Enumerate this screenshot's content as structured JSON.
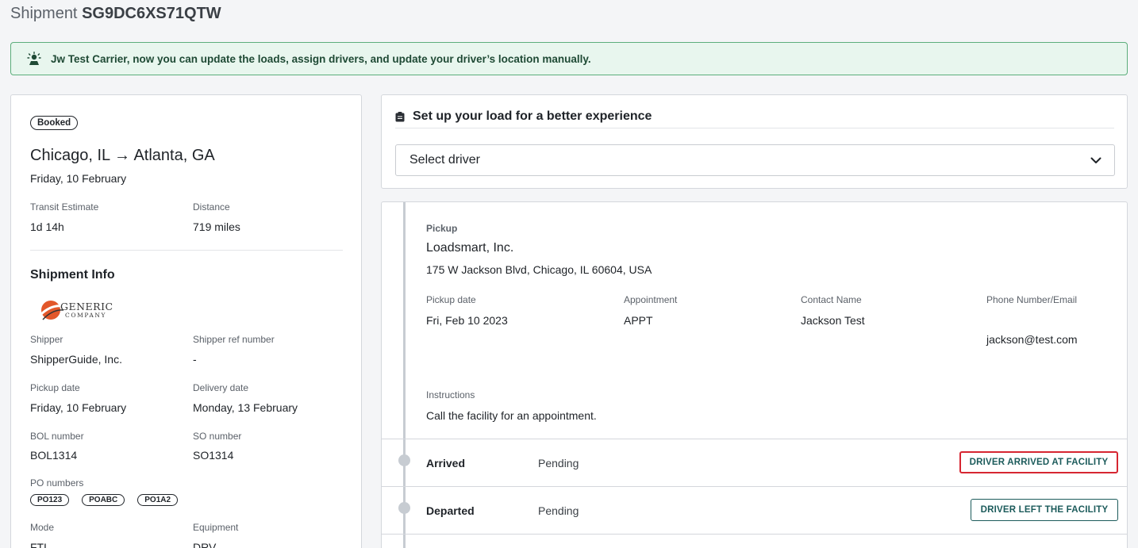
{
  "header": {
    "title_prefix": "Shipment",
    "shipment_id": "SG9DC6XS71QTW"
  },
  "banner": {
    "text": "Jw Test Carrier, now you can update the loads, assign drivers, and update your driver’s location manually."
  },
  "summary": {
    "status": "Booked",
    "route": "Chicago, IL → Atlanta, GA",
    "date": "Friday, 10 February",
    "transit_label": "Transit Estimate",
    "transit_value": "1d 14h",
    "distance_label": "Distance",
    "distance_value": "719 miles"
  },
  "shipment_info": {
    "title": "Shipment Info",
    "logo_line1": "GENERIC",
    "logo_line2": "COMPANY",
    "shipper_label": "Shipper",
    "shipper_value": "ShipperGuide, Inc.",
    "shipper_ref_label": "Shipper ref number",
    "shipper_ref_value": "-",
    "pickup_date_label": "Pickup date",
    "pickup_date_value": "Friday, 10 February",
    "delivery_date_label": "Delivery date",
    "delivery_date_value": "Monday, 13 February",
    "bol_label": "BOL number",
    "bol_value": "BOL1314",
    "so_label": "SO number",
    "so_value": "SO1314",
    "po_label": "PO numbers",
    "po_numbers": [
      "PO123",
      "POABC",
      "PO1A2"
    ],
    "mode_label": "Mode",
    "mode_value": "FTL",
    "equipment_label": "Equipment",
    "equipment_value": "DRV"
  },
  "setup": {
    "title": "Set up your load for a better experience",
    "driver_placeholder": "Select driver"
  },
  "pickup": {
    "label": "Pickup",
    "company": "Loadsmart, Inc.",
    "address": "175 W Jackson Blvd, Chicago, IL 60604, USA",
    "pickup_date_label": "Pickup date",
    "pickup_date_value": "Fri, Feb 10 2023",
    "appointment_label": "Appointment",
    "appointment_value": "APPT",
    "contact_label": "Contact Name",
    "contact_value": "Jackson Test",
    "phone_label": "Phone Number/Email",
    "phone_value": "jackson@test.com",
    "instructions_label": "Instructions",
    "instructions_value": "Call the facility for an appointment."
  },
  "events": [
    {
      "name": "Arrived",
      "status": "Pending",
      "action": "DRIVER ARRIVED AT FACILITY"
    },
    {
      "name": "Departed",
      "status": "Pending",
      "action": "DRIVER LEFT THE FACILITY"
    }
  ],
  "colors": {
    "accent": "#1c5b5b",
    "banner_bg": "#e8f6ee",
    "banner_border": "#5cae7b",
    "highlight": "#d62631"
  }
}
